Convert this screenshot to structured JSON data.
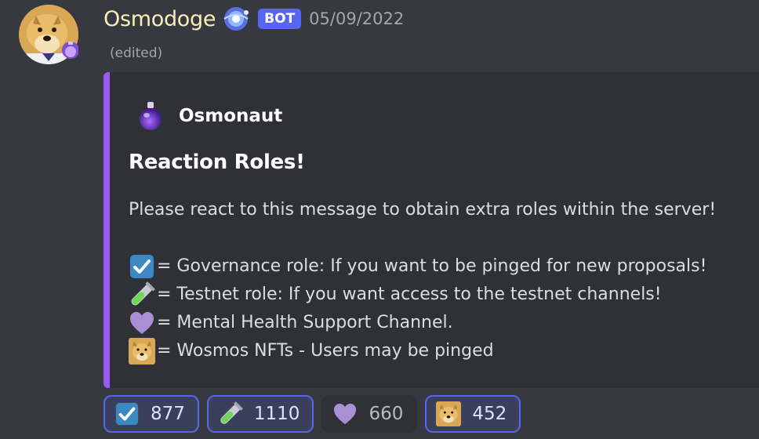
{
  "author": {
    "username": "Osmodoge",
    "bot_tag": "BOT",
    "timestamp": "05/09/2022",
    "edited_label": "(edited)"
  },
  "embed": {
    "accent_color": "#9b59f0",
    "author_name": "Osmonaut",
    "title": "Reaction Roles!",
    "intro": "Please react to this message to obtain extra roles within the server!",
    "roles": [
      {
        "emoji": "check-box-icon",
        "text": "= Governance role: If you want to be pinged for new proposals!"
      },
      {
        "emoji": "test-tube-icon",
        "text": "= Testnet role: If you want access to the testnet channels!"
      },
      {
        "emoji": "purple-heart-icon",
        "text": "= Mental Health Support Channel."
      },
      {
        "emoji": "doge-icon",
        "text": " = Wosmos NFTs - Users may be pinged"
      }
    ]
  },
  "reactions": [
    {
      "emoji": "check-box-icon",
      "count": "877",
      "active": true
    },
    {
      "emoji": "test-tube-icon",
      "count": "1110",
      "active": true
    },
    {
      "emoji": "purple-heart-icon",
      "count": "660",
      "active": false
    },
    {
      "emoji": "doge-icon",
      "count": "452",
      "active": true
    }
  ],
  "colors": {
    "background": "#36393f",
    "embed_background": "#2f3136",
    "username": "#f8efb9",
    "bot_tag": "#5865f2",
    "reaction_active_border": "#5865f2"
  }
}
